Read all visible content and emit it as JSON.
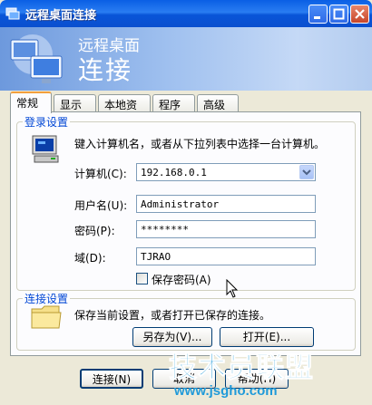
{
  "window": {
    "title": "远程桌面连接"
  },
  "banner": {
    "subtitle": "远程桌面",
    "title": "连接"
  },
  "tabs": [
    {
      "label": "常规"
    },
    {
      "label": "显示"
    },
    {
      "label": "本地资源"
    },
    {
      "label": "程序"
    },
    {
      "label": "高级"
    }
  ],
  "login": {
    "legend": "登录设置",
    "instruction": "键入计算机名，或者从下拉列表中选择一台计算机。",
    "computer_label": "计算机(C):",
    "computer_value": "192.168.0.1",
    "username_label": "用户名(U):",
    "username_value": "Administrator",
    "password_label": "密码(P):",
    "password_value": "********",
    "domain_label": "域(D):",
    "domain_value": "TJRAO",
    "save_password_label": "保存密码(A)"
  },
  "connection": {
    "legend": "连接设置",
    "description": "保存当前设置，或者打开已保存的连接。",
    "save_as_label": "另存为(V)...",
    "open_label": "打开(E)..."
  },
  "bottom_buttons": {
    "connect": "连接(N)",
    "cancel": "取消",
    "help": "帮助(H)"
  },
  "watermark": {
    "text": "技术员联盟",
    "url": "www.jsgho.com"
  }
}
